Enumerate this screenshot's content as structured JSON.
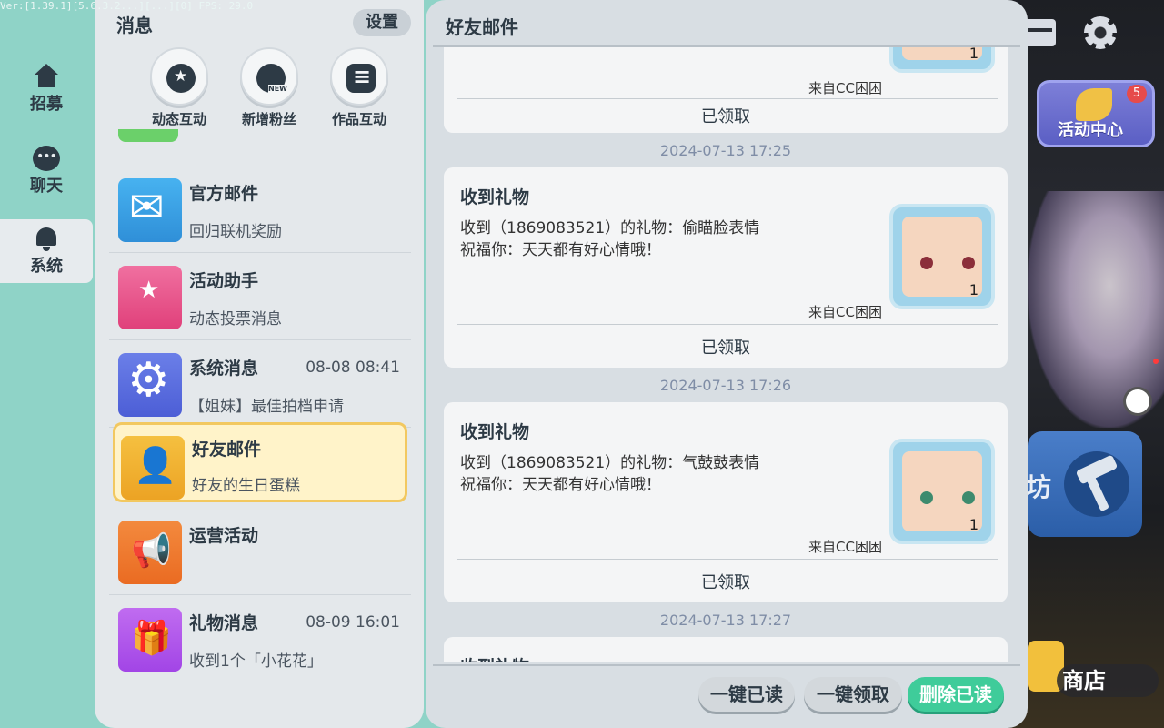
{
  "version_text": "Ver:[1.39.1][5.6.3.2...][...][0] FPS: 29.0",
  "nav": {
    "recruit": "招募",
    "chat": "聊天",
    "system": "系统"
  },
  "messages": {
    "title": "消息",
    "settings_label": "设置",
    "quick": [
      {
        "label": "动态互动",
        "icon": "star-bubble-icon"
      },
      {
        "label": "新增粉丝",
        "icon": "new-follower-icon",
        "tag": "NEW"
      },
      {
        "label": "作品互动",
        "icon": "list-icon"
      }
    ],
    "rows": [
      {
        "name": "官方邮件",
        "preview": "回归联机奖励",
        "time": "",
        "icon": "mail-icon"
      },
      {
        "name": "活动助手",
        "preview": "动态投票消息",
        "time": "",
        "icon": "bookmark-star-icon"
      },
      {
        "name": "系统消息",
        "preview": "【姐妹】最佳拍档申请",
        "time": "08-08 08:41",
        "icon": "gear-icon"
      },
      {
        "name": "好友邮件",
        "preview": "好友的生日蛋糕",
        "time": "",
        "icon": "friend-mail-icon",
        "selected": true
      },
      {
        "name": "运营活动",
        "preview": "",
        "time": "",
        "icon": "megaphone-icon"
      },
      {
        "name": "礼物消息",
        "preview": "收到1个「小花花」",
        "time": "08-09 16:01",
        "icon": "gift-icon"
      }
    ]
  },
  "mail": {
    "title": "好友邮件",
    "cards": [
      {
        "from": "来自CC困困",
        "status": "已领取",
        "count": "1"
      },
      {
        "timestamp": "2024-07-13 17:25",
        "title": "收到礼物",
        "line1": "收到（1869083521）的礼物：偷瞄脸表情",
        "line2": "祝福你：天天都有好心情哦！",
        "from": "来自CC困困",
        "status": "已领取",
        "count": "1"
      },
      {
        "timestamp": "2024-07-13 17:26",
        "title": "收到礼物",
        "line1": "收到（1869083521）的礼物：气鼓鼓表情",
        "line2": "祝福你：天天都有好心情哦！",
        "from": "来自CC困困",
        "status": "已领取",
        "count": "1"
      },
      {
        "timestamp": "2024-07-13 17:27",
        "title": "收到礼物"
      }
    ],
    "actions": {
      "mark_all_read": "一键已读",
      "claim_all": "一键领取",
      "delete_read": "删除已读"
    }
  },
  "hud": {
    "activity_center": "活动中心",
    "activity_badge": "5",
    "shop": "商店",
    "partial_text": "坊"
  }
}
